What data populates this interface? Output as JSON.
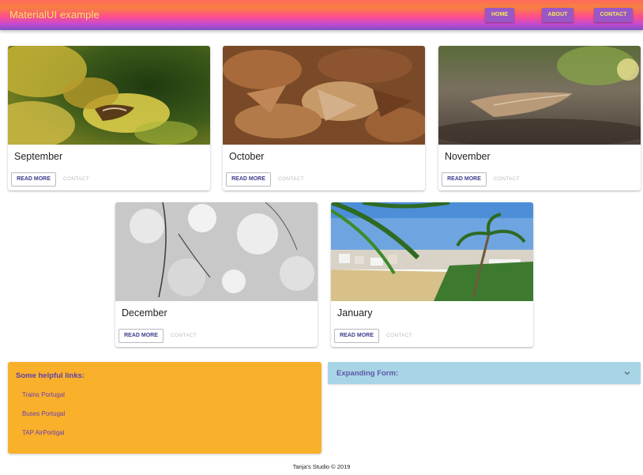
{
  "appbar": {
    "title": "MaterialUI example",
    "nav": [
      {
        "label": "Home"
      },
      {
        "label": "About"
      },
      {
        "label": "Contact"
      }
    ]
  },
  "cards": [
    {
      "title": "September",
      "read_more": "Read more",
      "contact": "Contact",
      "image": "yellow-autumn-leaves-photo"
    },
    {
      "title": "October",
      "read_more": "Read more",
      "contact": "Contact",
      "image": "brown-fallen-leaves-photo"
    },
    {
      "title": "November",
      "read_more": "Read more",
      "contact": "Contact",
      "image": "dry-leaf-on-ground-photo"
    },
    {
      "title": "December",
      "read_more": "Read more",
      "contact": "Contact",
      "image": "frosty-branches-photo"
    },
    {
      "title": "January",
      "read_more": "Read more",
      "contact": "Contact",
      "image": "palm-beach-town-photo"
    }
  ],
  "helpful_links": {
    "heading": "Some helpful links:",
    "items": [
      "Trains Portugal",
      "Buses Portugal",
      "TAP AirPortigal"
    ]
  },
  "expanding_form": {
    "label": "Expanding Form:",
    "icon": "chevron-down-icon"
  },
  "footer": {
    "text": "Tanja's Studio © 2019"
  },
  "colors": {
    "brand_text": "#f5e85a",
    "nav_button": "#9a58c6",
    "links_panel": "#f9b02a",
    "expand_panel": "#a8d5e5"
  }
}
